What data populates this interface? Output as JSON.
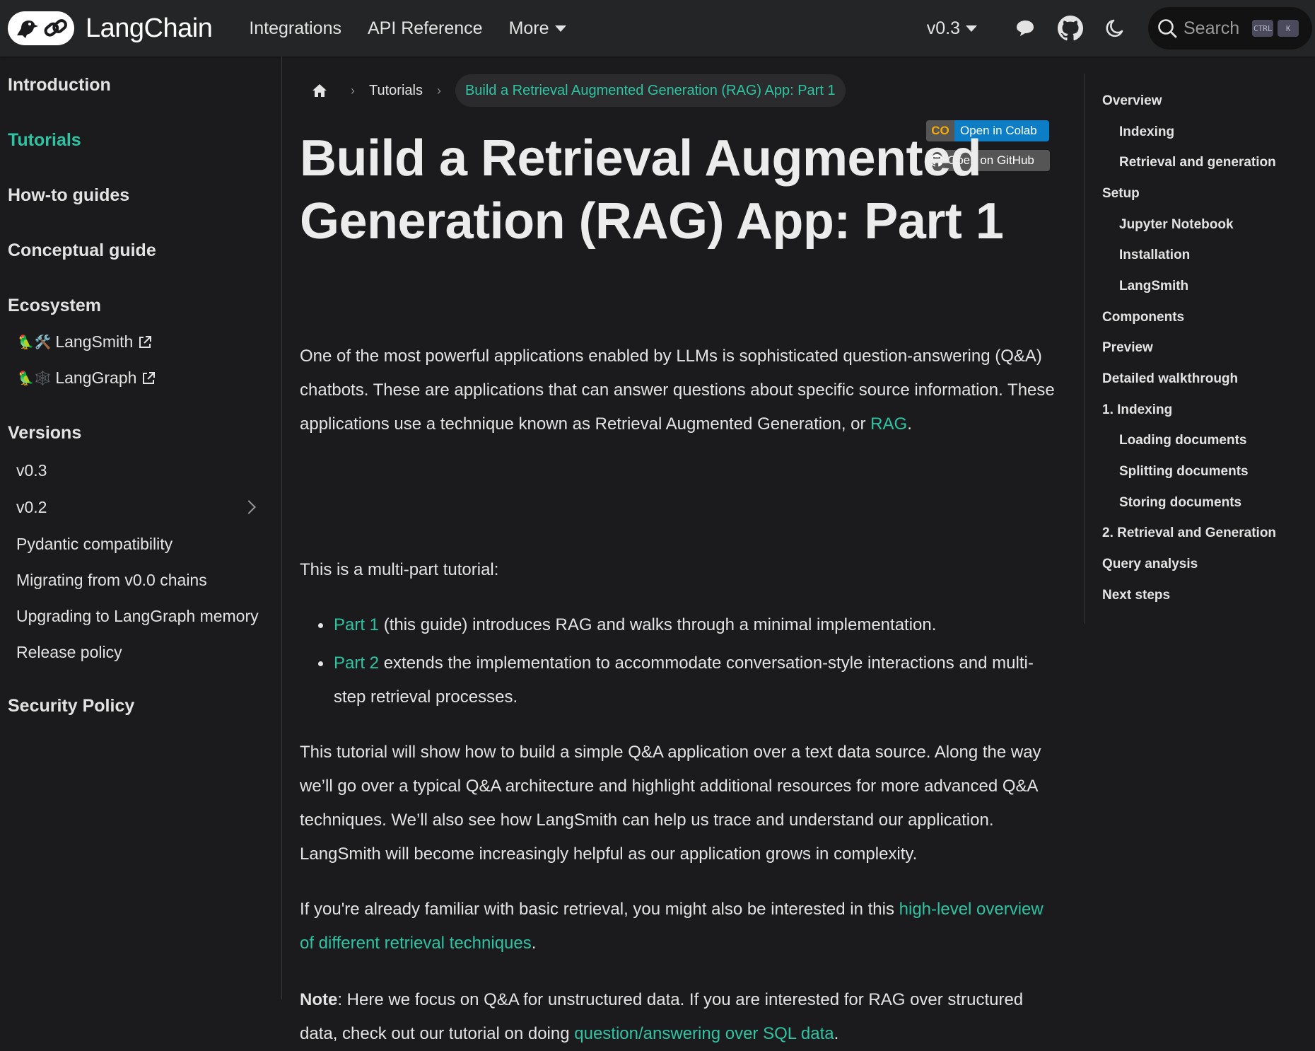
{
  "navbar": {
    "brand": "LangChain",
    "links": [
      "Integrations",
      "API Reference",
      "More"
    ],
    "version": "v0.3",
    "search_label": "Search",
    "kbd_ctrl": "CTRL",
    "kbd_k": "K"
  },
  "sidebar": {
    "introduction": "Introduction",
    "tutorials": "Tutorials",
    "howto": "How-to guides",
    "conceptual": "Conceptual guide",
    "ecosystem": "Ecosystem",
    "langsmith": "LangSmith",
    "langgraph": "LangGraph",
    "versions": "Versions",
    "v03": "v0.3",
    "v02": "v0.2",
    "pydantic": "Pydantic compatibility",
    "migrating": "Migrating from v0.0 chains",
    "upgrading": "Upgrading to LangGraph memory",
    "release": "Release policy",
    "security": "Security Policy",
    "langsmith_emoji": "🦜🛠️",
    "langgraph_emoji": "🦜🕸️"
  },
  "breadcrumb": {
    "tutorials": "Tutorials",
    "current": "Build a Retrieval Augmented Generation (RAG) App: Part 1"
  },
  "badges": {
    "colab": "Open in Colab",
    "colab_logo": "CO",
    "github": "Open on GitHub"
  },
  "article": {
    "title": "Build a Retrieval Augmented Generation (RAG) App: Part 1",
    "p1": "One of the most powerful applications enabled by LLMs is sophisticated question-answering (Q&A) chatbots. These are applications that can answer questions about specific source information. These applications use a technique known as Retrieval Augmented Generation, or ",
    "p1_link": "RAG",
    "p1_end": ".",
    "p2": "This is a multi-part tutorial:",
    "li1_link": "Part 1",
    "li1": " (this guide) introduces RAG and walks through a minimal implementation.",
    "li2_link": "Part 2",
    "li2": " extends the implementation to accommodate conversation-style interactions and multi-step retrieval processes.",
    "p3": "This tutorial will show how to build a simple Q&A application over a text data source. Along the way we’ll go over a typical Q&A architecture and highlight additional resources for more advanced Q&A techniques. We’ll also see how LangSmith can help us trace and understand our application. LangSmith will become increasingly helpful as our application grows in complexity.",
    "p4": "If you're already familiar with basic retrieval, you might also be interested in this ",
    "p4_link": "high-level overview of different retrieval techniques",
    "p4_end": ".",
    "note_label": "Note",
    "note": ": Here we focus on Q&A for unstructured data. If you are interested for RAG over structured data, check out our tutorial on doing ",
    "note_link": "question/answering over SQL data",
    "note_end": "."
  },
  "toc": {
    "overview": "Overview",
    "indexing": "Indexing",
    "retrieval_gen": "Retrieval and generation",
    "setup": "Setup",
    "jupyter": "Jupyter Notebook",
    "installation": "Installation",
    "langsmith": "LangSmith",
    "components": "Components",
    "preview": "Preview",
    "walkthrough": "Detailed walkthrough",
    "indexing1": "1. Indexing",
    "loading": "Loading documents",
    "splitting": "Splitting documents",
    "storing": "Storing documents",
    "retrieval2": "2. Retrieval and Generation",
    "query": "Query analysis",
    "next": "Next steps"
  },
  "colors": {
    "accent": "#2dc4a3",
    "background": "#1b1b1d",
    "navbar": "#242526",
    "colab_blue": "#0d7ec6"
  },
  "icons": [
    "parrot-chain-logo",
    "caret-down-icon",
    "chat-bubble-icon",
    "github-icon",
    "moon-icon",
    "search-icon",
    "home-icon",
    "chevron-right-icon",
    "external-link-icon",
    "colab-logo-icon"
  ]
}
